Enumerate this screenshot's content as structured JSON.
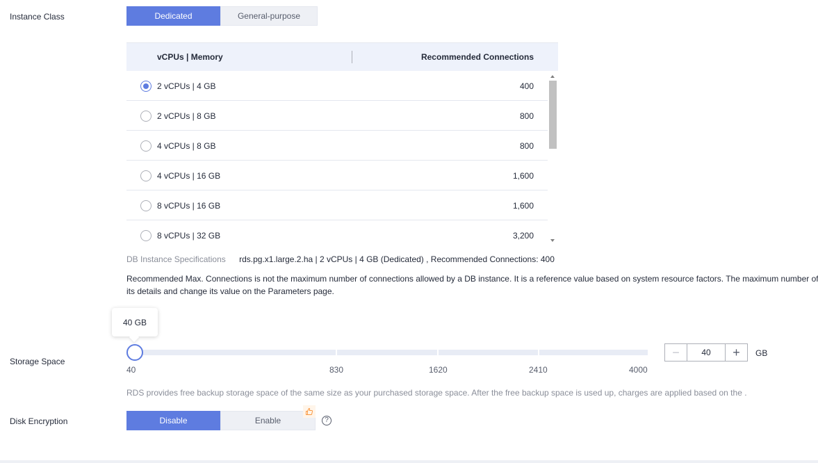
{
  "instance_class": {
    "label": "Instance Class",
    "options": [
      "Dedicated",
      "General-purpose"
    ],
    "selected": "Dedicated"
  },
  "flavor_table": {
    "columns": [
      "vCPUs | Memory",
      "Recommended Connections"
    ],
    "rows": [
      {
        "spec": "2 vCPUs | 4 GB",
        "connections": "400",
        "selected": true
      },
      {
        "spec": "2 vCPUs | 8 GB",
        "connections": "800",
        "selected": false
      },
      {
        "spec": "4 vCPUs | 8 GB",
        "connections": "800",
        "selected": false
      },
      {
        "spec": "4 vCPUs | 16 GB",
        "connections": "1,600",
        "selected": false
      },
      {
        "spec": "8 vCPUs | 16 GB",
        "connections": "1,600",
        "selected": false
      },
      {
        "spec": "8 vCPUs | 32 GB",
        "connections": "3,200",
        "selected": false
      }
    ]
  },
  "db_spec": {
    "label": "DB Instance Specifications",
    "value": "rds.pg.x1.large.2.ha | 2 vCPUs | 4 GB (Dedicated) , Recommended Connections: 400"
  },
  "connections_note": {
    "line1": "Recommended Max. Connections is not the maximum number of connections allowed by a DB instance. It is a reference value based on system resource factors. The maximum number of",
    "line2": "its details and change its value on the Parameters page."
  },
  "storage": {
    "label": "Storage Space",
    "tooltip": "40 GB",
    "ticks": [
      "40",
      "830",
      "1620",
      "2410",
      "4000"
    ],
    "value": "40",
    "unit": "GB",
    "minus": "−",
    "plus": "+",
    "note": "RDS provides free backup storage space of the same size as your purchased storage space. After the free backup space is used up, charges are applied based on the ."
  },
  "disk_encryption": {
    "label": "Disk Encryption",
    "options": [
      "Disable",
      "Enable"
    ],
    "selected": "Disable",
    "help": "?"
  },
  "colors": {
    "accent": "#5e7ce0",
    "badge": "#fa9841"
  }
}
